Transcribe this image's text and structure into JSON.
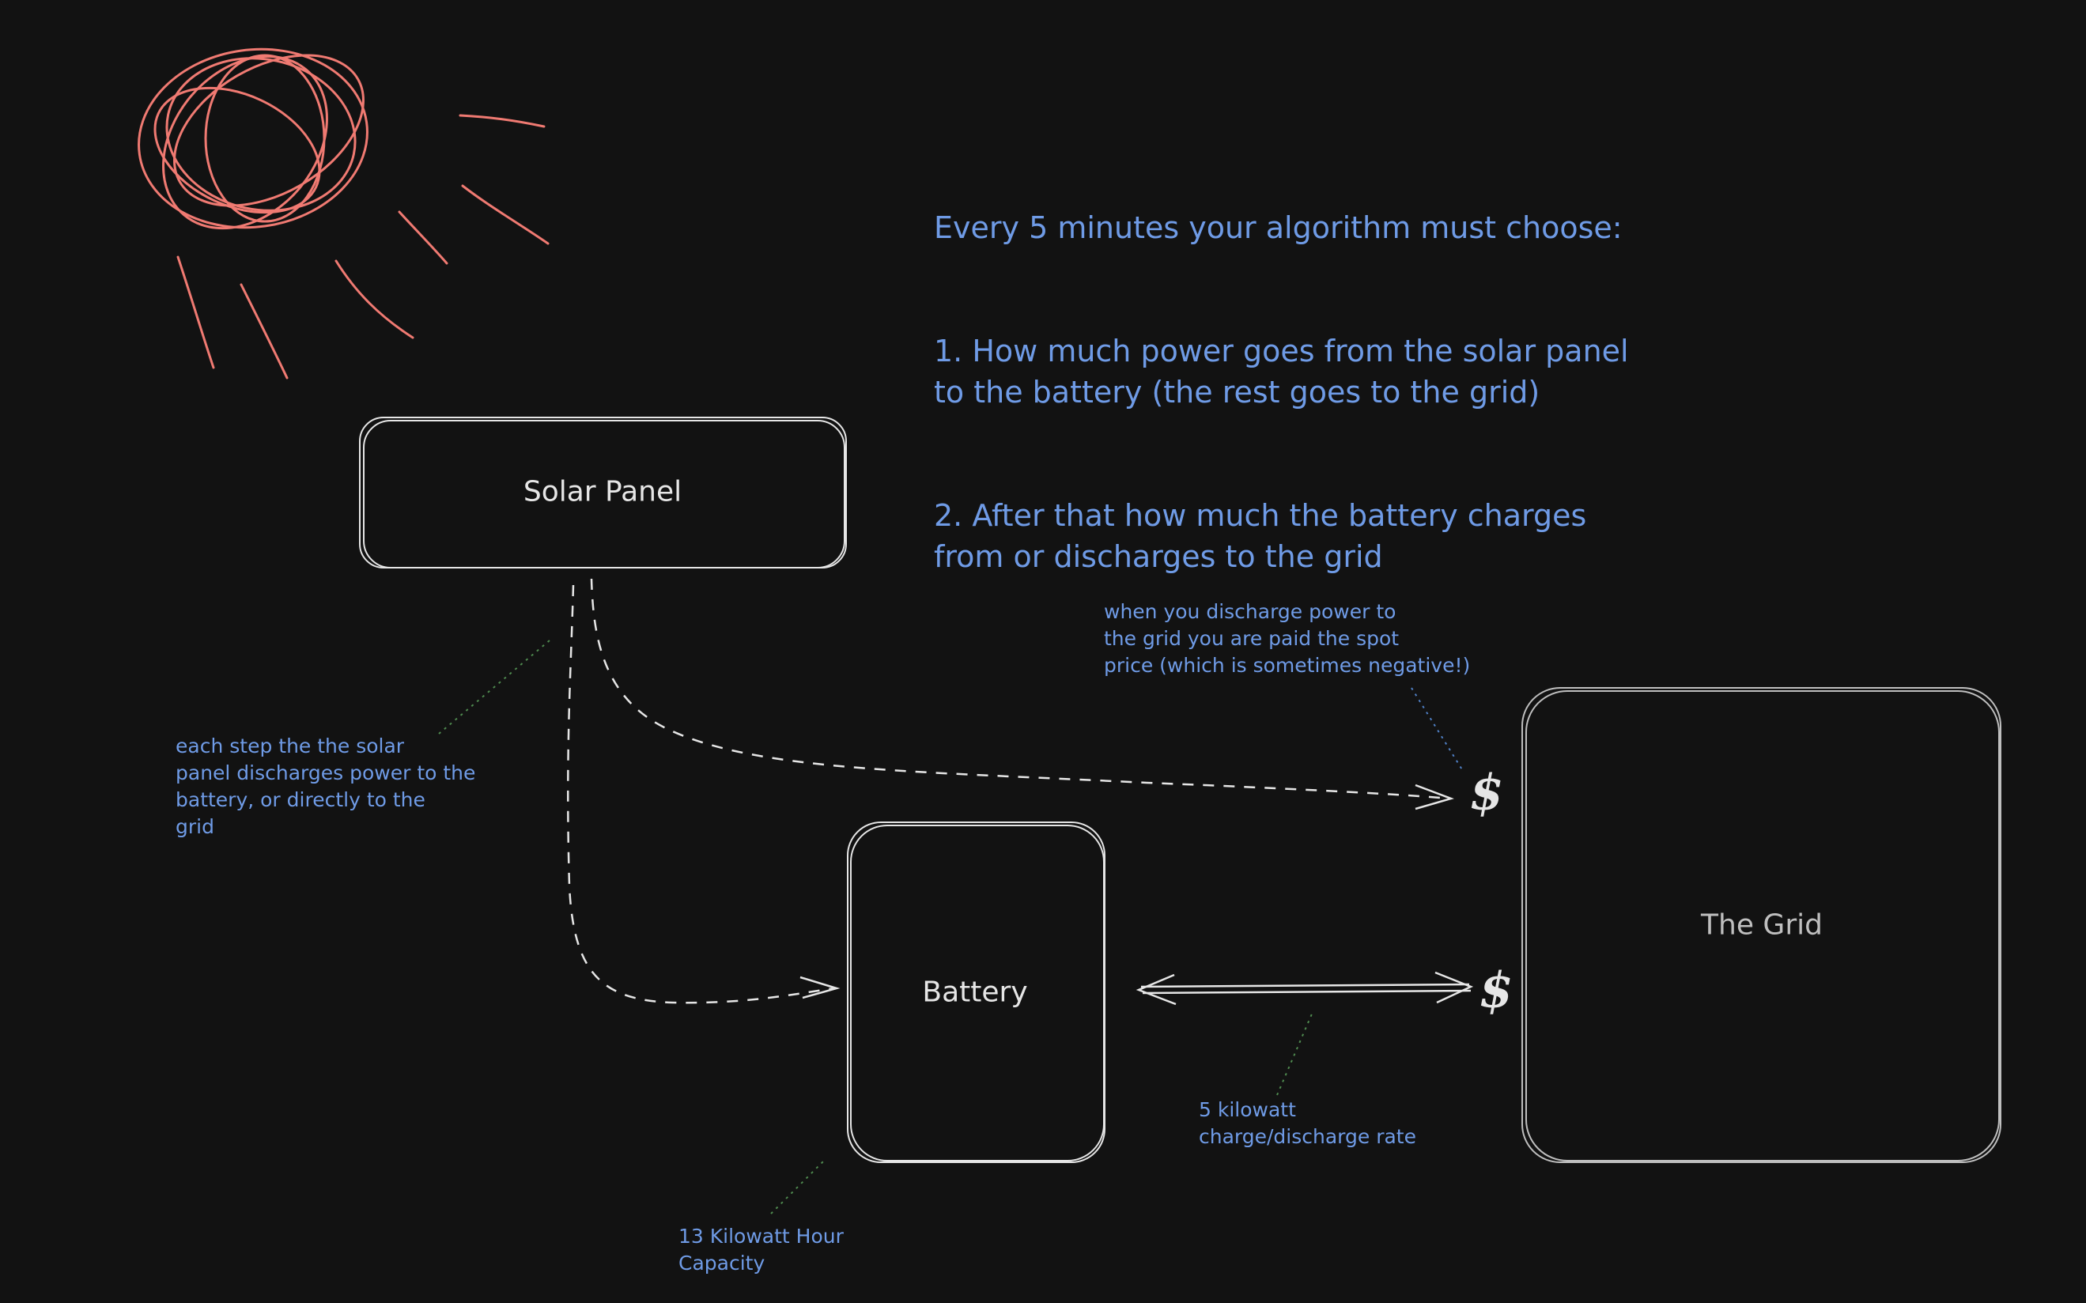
{
  "heading": {
    "line1": "Every 5 minutes your algorithm must choose:",
    "item1": "1. How much power goes from the solar panel\nto the battery (the rest goes to the grid)",
    "item2": "2. After that how much the battery charges\nfrom or discharges to the grid"
  },
  "nodes": {
    "solar_panel": "Solar Panel",
    "battery": "Battery",
    "grid": "The Grid"
  },
  "annotations": {
    "solar_step": "each step the the solar\npanel discharges power to the\nbattery, or directly to the\ngrid",
    "spot_price": "when you discharge power to\nthe grid you are paid the spot\nprice (which is sometimes negative!)",
    "rate": "5 kilowatt\ncharge/discharge rate",
    "capacity": "13 Kilowatt Hour\nCapacity"
  },
  "symbols": {
    "top_dollar": "$",
    "bottom_dollar": "$"
  },
  "colors": {
    "background": "#121212",
    "sun": "#f07a72",
    "text_blue": "#6f9be6",
    "stroke": "#e6e6e6",
    "grid_stroke": "#bfbfbf",
    "leader_green": "#4f8a4f"
  },
  "icons": {
    "sun": "sun-icon"
  }
}
